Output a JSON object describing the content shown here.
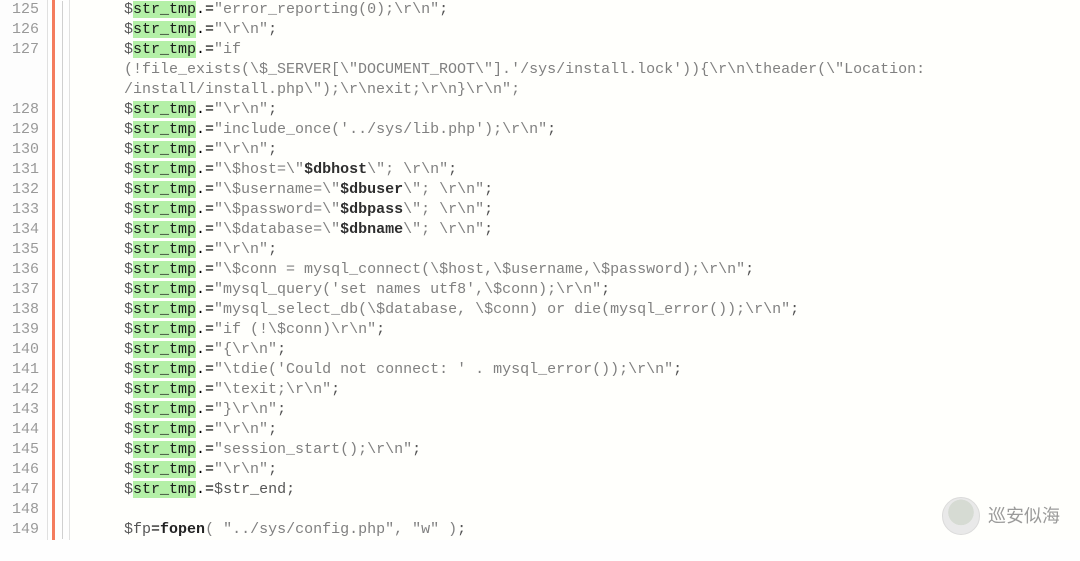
{
  "gutter_lines": [
    "125",
    "126",
    "127",
    "",
    "",
    "128",
    "129",
    "130",
    "131",
    "132",
    "133",
    "134",
    "135",
    "136",
    "137",
    "138",
    "139",
    "140",
    "141",
    "142",
    "143",
    "144",
    "145",
    "146",
    "147",
    "148",
    "149"
  ],
  "code": {
    "l125": {
      "var": "str_tmp",
      "str": "\"error_reporting(0);\\r\\n\""
    },
    "l126": {
      "var": "str_tmp",
      "str": "\"\\r\\n\""
    },
    "l127": {
      "var": "str_tmp",
      "str_open": "\"if"
    },
    "l127w1": "(!file_exists(\\$_SERVER[\\\"DOCUMENT_ROOT\\\"].'/sys/install.lock')){\\r\\n\\theader(\\\"Location:",
    "l127w2": "/install/install.php\\\");\\r\\nexit;\\r\\n}\\r\\n\";",
    "l128": {
      "var": "str_tmp",
      "str": "\"\\r\\n\""
    },
    "l129": {
      "var": "str_tmp",
      "str": "\"include_once('../sys/lib.php');\\r\\n\""
    },
    "l130": {
      "var": "str_tmp",
      "str": "\"\\r\\n\""
    },
    "l131": {
      "var": "str_tmp",
      "pre": "\"\\$host=\\\"",
      "bold": "$dbhost",
      "post": "\\\"; \\r\\n\""
    },
    "l132": {
      "var": "str_tmp",
      "pre": "\"\\$username=\\\"",
      "bold": "$dbuser",
      "post": "\\\"; \\r\\n\""
    },
    "l133": {
      "var": "str_tmp",
      "pre": "\"\\$password=\\\"",
      "bold": "$dbpass",
      "post": "\\\"; \\r\\n\""
    },
    "l134": {
      "var": "str_tmp",
      "pre": "\"\\$database=\\\"",
      "bold": "$dbname",
      "post": "\\\"; \\r\\n\""
    },
    "l135": {
      "var": "str_tmp",
      "str": "\"\\r\\n\""
    },
    "l136": {
      "var": "str_tmp",
      "str": "\"\\$conn = mysql_connect(\\$host,\\$username,\\$password);\\r\\n\""
    },
    "l137": {
      "var": "str_tmp",
      "str": "\"mysql_query('set names utf8',\\$conn);\\r\\n\""
    },
    "l138": {
      "var": "str_tmp",
      "str": "\"mysql_select_db(\\$database, \\$conn) or die(mysql_error());\\r\\n\""
    },
    "l139": {
      "var": "str_tmp",
      "str": "\"if (!\\$conn)\\r\\n\""
    },
    "l140": {
      "var": "str_tmp",
      "str": "\"{\\r\\n\""
    },
    "l141": {
      "var": "str_tmp",
      "str": "\"\\tdie('Could not connect: ' . mysql_error());\\r\\n\""
    },
    "l142": {
      "var": "str_tmp",
      "str": "\"\\texit;\\r\\n\""
    },
    "l143": {
      "var": "str_tmp",
      "str": "\"}\\r\\n\""
    },
    "l144": {
      "var": "str_tmp",
      "str": "\"\\r\\n\""
    },
    "l145": {
      "var": "str_tmp",
      "str": "\"session_start();\\r\\n\""
    },
    "l146": {
      "var": "str_tmp",
      "str": "\"\\r\\n\""
    },
    "l147": {
      "var": "str_tmp",
      "rhs_var": "str_end"
    },
    "l149": {
      "var": "fp",
      "fn": "fopen",
      "args": "( \"../sys/config.php\", \"w\" )"
    }
  },
  "watermark_text": "巡安似海"
}
